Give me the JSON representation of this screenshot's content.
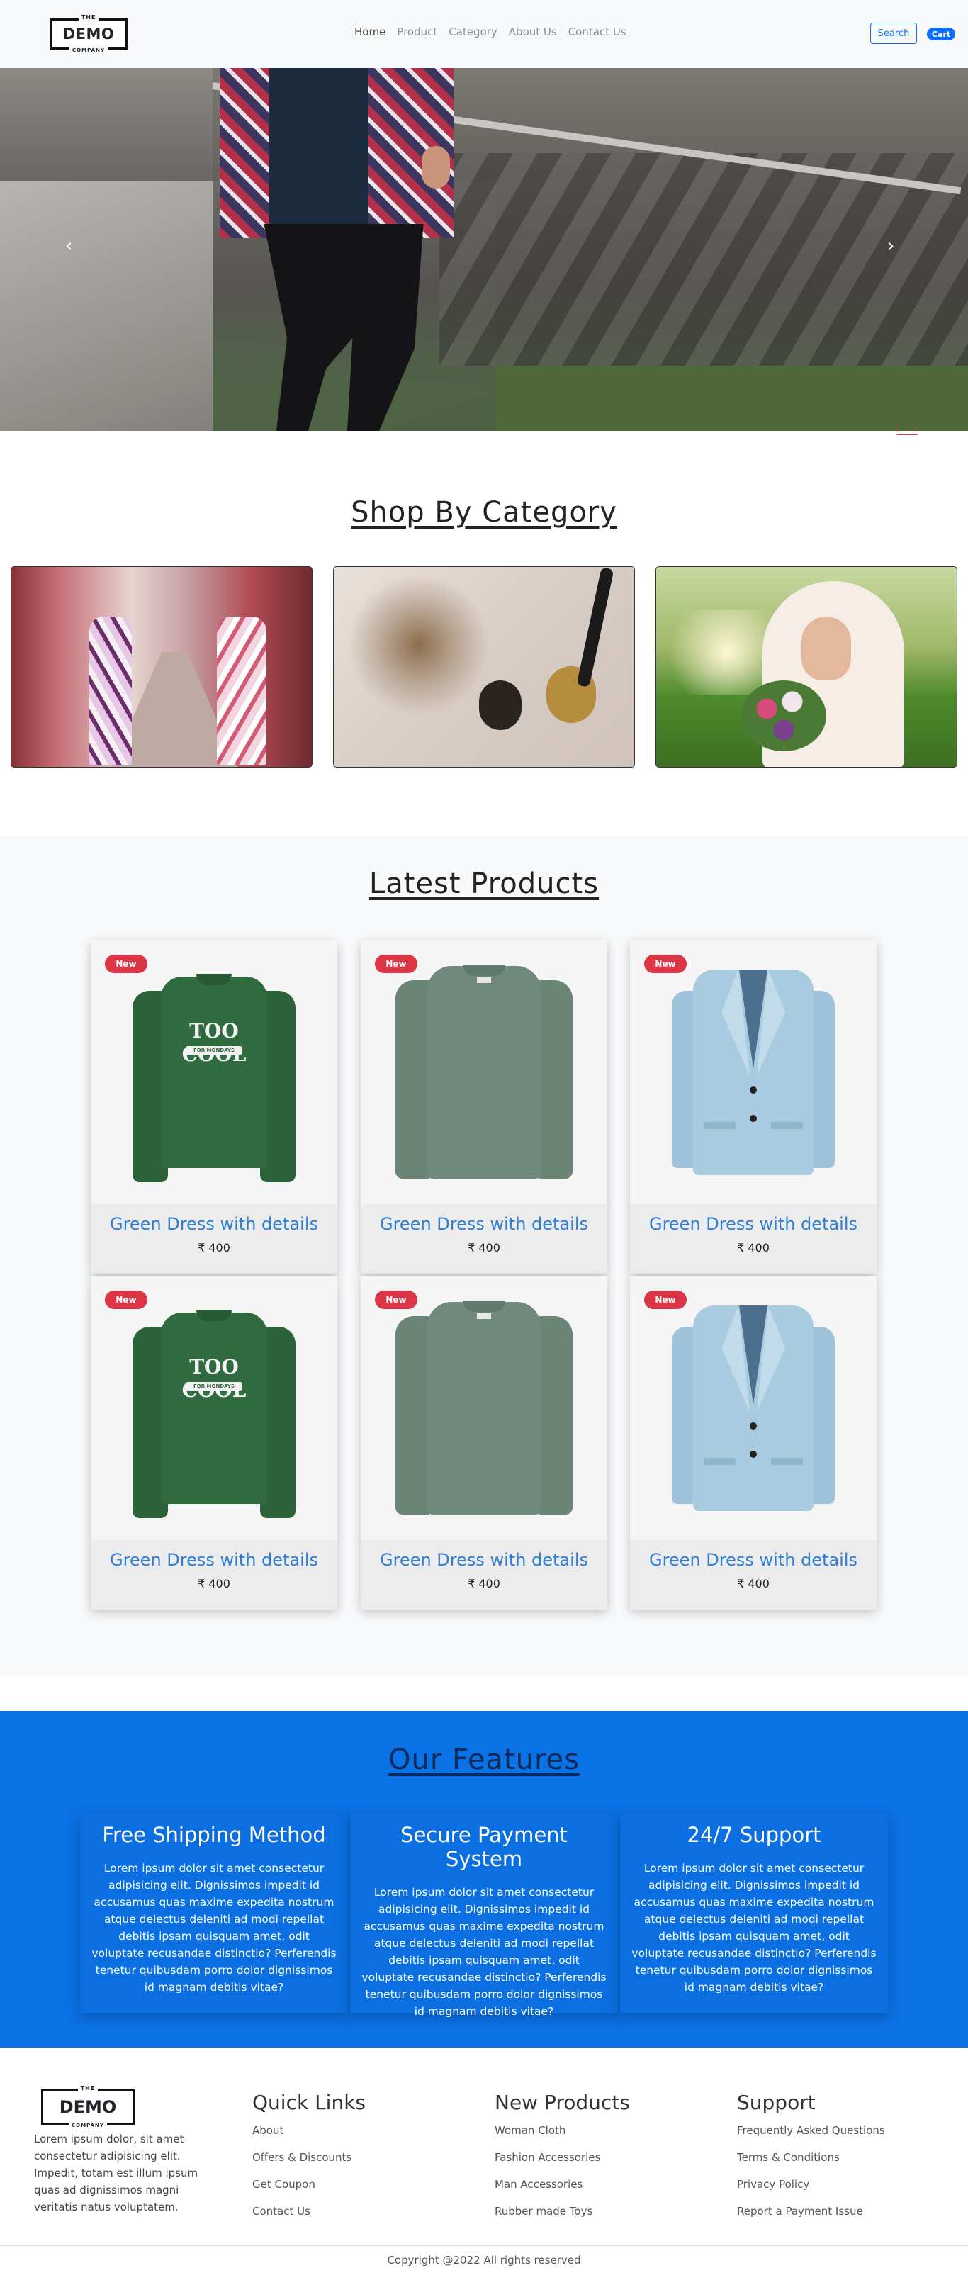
{
  "nav": {
    "logo": {
      "top": "THE",
      "main": "DEMO",
      "bottom": "COMPANY"
    },
    "links": [
      {
        "label": "Home",
        "active": true
      },
      {
        "label": "Product",
        "active": false
      },
      {
        "label": "Category",
        "active": false
      },
      {
        "label": "About Us",
        "active": false
      },
      {
        "label": "Contact Us",
        "active": false
      }
    ],
    "search_label": "Search",
    "cart_label": "Cart"
  },
  "hero": {
    "prev_icon": "chevron-left-icon",
    "next_icon": "chevron-right-icon",
    "prev_glyph": "‹",
    "next_glyph": "›"
  },
  "category": {
    "title": "Shop By Category"
  },
  "latest": {
    "title": "Latest Products",
    "products": [
      {
        "badge": "New",
        "name": "Green Dress with details",
        "price": "₹ 400"
      },
      {
        "badge": "New",
        "name": "Green Dress with details",
        "price": "₹ 400"
      },
      {
        "badge": "New",
        "name": "Green Dress with details",
        "price": "₹ 400"
      },
      {
        "badge": "New",
        "name": "Green Dress with details",
        "price": "₹ 400"
      },
      {
        "badge": "New",
        "name": "Green Dress with details",
        "price": "₹ 400"
      },
      {
        "badge": "New",
        "name": "Green Dress with details",
        "price": "₹ 400"
      }
    ],
    "print_text": {
      "line1": "TOO COOL",
      "line2": "FOR MONDAYS"
    }
  },
  "features": {
    "title": "Our Features",
    "items": [
      {
        "title": "Free Shipping Method",
        "text": "Lorem ipsum dolor sit amet consectetur adipisicing elit. Dignissimos impedit id accusamus quas maxime expedita nostrum atque delectus deleniti ad modi repellat debitis ipsam quisquam amet, odit voluptate recusandae distinctio? Perferendis tenetur quibusdam porro dolor dignissimos id magnam debitis vitae?"
      },
      {
        "title": "Secure Payment System",
        "text": "Lorem ipsum dolor sit amet consectetur adipisicing elit. Dignissimos impedit id accusamus quas maxime expedita nostrum atque delectus deleniti ad modi repellat debitis ipsam quisquam amet, odit voluptate recusandae distinctio? Perferendis tenetur quibusdam porro dolor dignissimos id magnam debitis vitae?"
      },
      {
        "title": "24/7 Support",
        "text": "Lorem ipsum dolor sit amet consectetur adipisicing elit. Dignissimos impedit id accusamus quas maxime expedita nostrum atque delectus deleniti ad modi repellat debitis ipsam quisquam amet, odit voluptate recusandae distinctio? Perferendis tenetur quibusdam porro dolor dignissimos id magnam debitis vitae?"
      }
    ]
  },
  "footer": {
    "logo": {
      "top": "THE",
      "main": "DEMO",
      "bottom": "COMPANY"
    },
    "about": "Lorem ipsum dolor, sit amet consectetur adipisicing elit. Impedit, totam est illum ipsum quas ad dignissimos magni veritatis natus voluptatem.",
    "quick_links": {
      "title": "Quick Links",
      "items": [
        "About",
        "Offers & Discounts",
        "Get Coupon",
        "Contact Us"
      ]
    },
    "new_products": {
      "title": "New Products",
      "items": [
        "Woman Cloth",
        "Fashion Accessories",
        "Man Accessories",
        "Rubber made Toys"
      ]
    },
    "support": {
      "title": "Support",
      "items": [
        "Frequently Asked Questions",
        "Terms & Conditions",
        "Privacy Policy",
        "Report a Payment Issue"
      ]
    },
    "copyright": "Copyright @2022 All rights reserved"
  },
  "colors": {
    "accent": "#0d6efd",
    "badge": "#dc3545",
    "features_bg": "#0b72e6",
    "product_link": "#2f7fd6"
  }
}
